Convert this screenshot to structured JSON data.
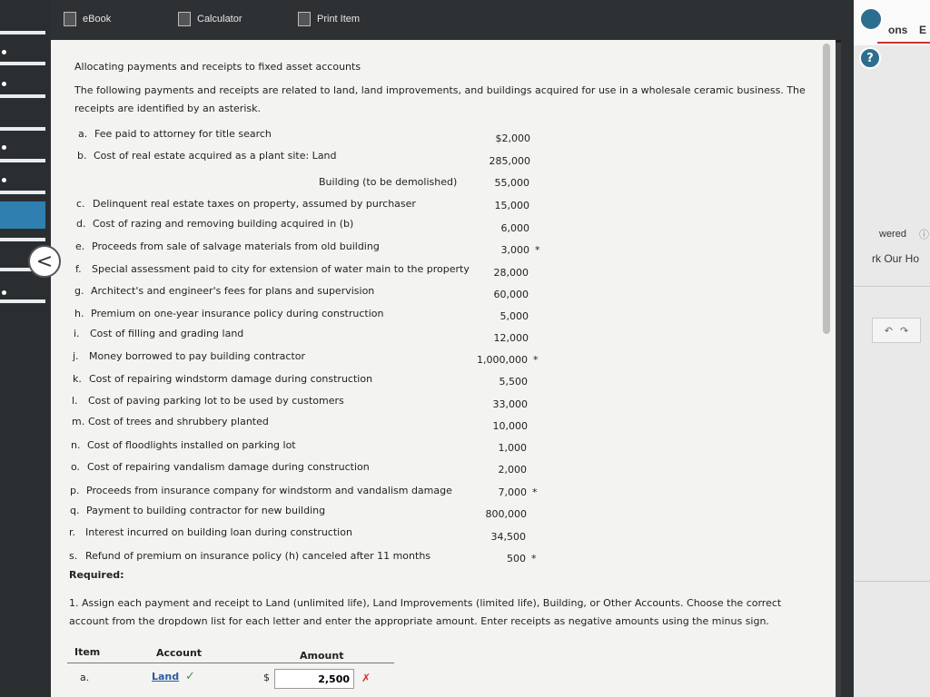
{
  "toolbar": {
    "ebook_label": "eBook",
    "calculator_label": "Calculator",
    "print_label": "Print Item"
  },
  "right_panel": {
    "tab_partial_1": "ons",
    "tab_partial_2": "E",
    "answered_partial": "wered",
    "work_partial": "rk Our Ho",
    "help_icon": "?"
  },
  "problem": {
    "title": "Allocating payments and receipts to fixed asset accounts",
    "intro_line1": "The following payments and receipts are related to land, land improvements, and buildings acquired for use in a wholesale ceramic business. The",
    "intro_line2": "receipts are identified by an asterisk.",
    "items": [
      {
        "letter": "a.",
        "text": "Fee paid to attorney for title search",
        "amount": "$2,000",
        "receipt": false
      },
      {
        "letter": "b.",
        "text": "Cost of real estate acquired as a plant site: Land",
        "amount": "285,000",
        "receipt": false
      },
      {
        "letter": "",
        "text": "Building (to be demolished)",
        "amount": "55,000",
        "receipt": false
      },
      {
        "letter": "c.",
        "text": "Delinquent real estate taxes on property, assumed by purchaser",
        "amount": "15,000",
        "receipt": false
      },
      {
        "letter": "d.",
        "text": "Cost of razing and removing building acquired in (b)",
        "amount": "6,000",
        "receipt": false
      },
      {
        "letter": "e.",
        "text": "Proceeds from sale of salvage materials from old building",
        "amount": "3,000",
        "receipt": true
      },
      {
        "letter": "f.",
        "text": "Special assessment paid to city for extension of water main to the property",
        "amount": "28,000",
        "receipt": false
      },
      {
        "letter": "g.",
        "text": "Architect's and engineer's fees for plans and supervision",
        "amount": "60,000",
        "receipt": false
      },
      {
        "letter": "h.",
        "text": "Premium on one-year insurance policy during construction",
        "amount": "5,000",
        "receipt": false
      },
      {
        "letter": "i.",
        "text": "Cost of filling and grading land",
        "amount": "12,000",
        "receipt": false
      },
      {
        "letter": "j.",
        "text": "Money borrowed to pay building contractor",
        "amount": "1,000,000",
        "receipt": true
      },
      {
        "letter": "k.",
        "text": "Cost of repairing windstorm damage during construction",
        "amount": "5,500",
        "receipt": false
      },
      {
        "letter": "l.",
        "text": "Cost of paving parking lot to be used by customers",
        "amount": "33,000",
        "receipt": false
      },
      {
        "letter": "m.",
        "text": "Cost of trees and shrubbery planted",
        "amount": "10,000",
        "receipt": false
      },
      {
        "letter": "n.",
        "text": "Cost of floodlights installed on parking lot",
        "amount": "1,000",
        "receipt": false
      },
      {
        "letter": "o.",
        "text": "Cost of repairing vandalism damage during construction",
        "amount": "2,000",
        "receipt": false
      },
      {
        "letter": "p.",
        "text": "Proceeds from insurance company for windstorm and vandalism damage",
        "amount": "7,000",
        "receipt": true
      },
      {
        "letter": "q.",
        "text": "Payment to building contractor for new building",
        "amount": "800,000",
        "receipt": false
      },
      {
        "letter": "r.",
        "text": "Interest incurred on building loan during construction",
        "amount": "34,500",
        "receipt": false
      },
      {
        "letter": "s.",
        "text": "Refund of premium on insurance policy (h) canceled after 11 months",
        "amount": "500",
        "receipt": true
      }
    ],
    "asterisk": "*",
    "required_label": "Required:",
    "instruction_line1": "1. Assign each payment and receipt to Land (unlimited life), Land Improvements (limited life), Building, or Other Accounts. Choose the correct",
    "instruction_line2": "account from the dropdown list for each letter and enter the appropriate amount. Enter receipts as negative amounts using the minus sign."
  },
  "answer_table": {
    "headers": {
      "item": "Item",
      "account": "Account",
      "amount": "Amount"
    },
    "rows": [
      {
        "item": "a.",
        "account": "Land",
        "currency": "$",
        "amount": "2,500",
        "account_correct": true,
        "amount_correct": false
      }
    ]
  }
}
